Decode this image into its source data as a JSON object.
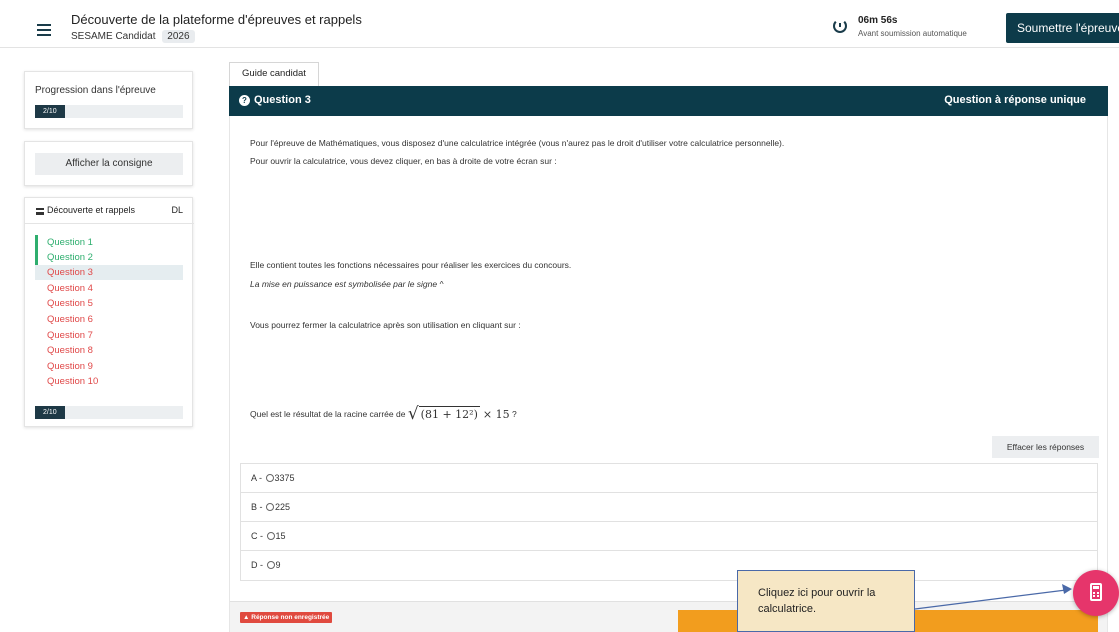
{
  "header": {
    "title": "Découverte de la plateforme d'épreuves et rappels",
    "subtitle": "SESAME Candidat",
    "year": "2026",
    "timer": "06m 56s",
    "timer_sub": "Avant soumission automatique",
    "submit_label": "Soumettre l'épreuve"
  },
  "sidebar": {
    "progress_label": "Progression dans l'épreuve",
    "progress_text": "2/10",
    "progress_fraction": 0.2,
    "consigne_label": "Afficher la consigne",
    "list_title": "Découverte et rappels",
    "list_badge": "DL",
    "questions": [
      "Question 1",
      "Question 2",
      "Question 3",
      "Question 4",
      "Question 5",
      "Question 6",
      "Question 7",
      "Question 8",
      "Question 9",
      "Question 10"
    ],
    "bottom_progress_text": "2/10"
  },
  "main": {
    "guide_tab": "Guide candidat",
    "question_title": "Question 3",
    "question_type": "Question à réponse unique",
    "p1": "Pour l'épreuve de Mathématiques, vous disposez d'une calculatrice intégrée (vous n'aurez pas le droit d'utiliser votre calculatrice personnelle).",
    "p2": "Pour ouvrir la calculatrice, vous devez cliquer, en bas à droite de votre écran sur :",
    "p3": "Elle contient toutes les fonctions nécessaires pour réaliser les exercices du concours.",
    "p4": "La mise en puissance est symbolisée par le signe ^",
    "p5": "Vous pourrez fermer la calculatrice après son utilisation en cliquant sur :",
    "question_prefix": "Quel est le résultat de la racine carrée de",
    "math_inner": "(81 + 12²)",
    "math_tail": "× 15",
    "question_suffix": "?",
    "clear_label": "Effacer les réponses",
    "answers": [
      {
        "letter": "A -",
        "value": "3375"
      },
      {
        "letter": "B -",
        "value": "225"
      },
      {
        "letter": "C -",
        "value": "15"
      },
      {
        "letter": "D -",
        "value": "9"
      }
    ],
    "status_badge": "Réponse non enregistrée"
  },
  "callout": {
    "text": "Cliquez ici pour ouvrir la calculatrice."
  },
  "colors": {
    "brand": "#0c3b4a",
    "done": "#2eae6e",
    "todo": "#e04848",
    "accent_orange": "#f29d1e",
    "calc_fab": "#e6356b"
  }
}
